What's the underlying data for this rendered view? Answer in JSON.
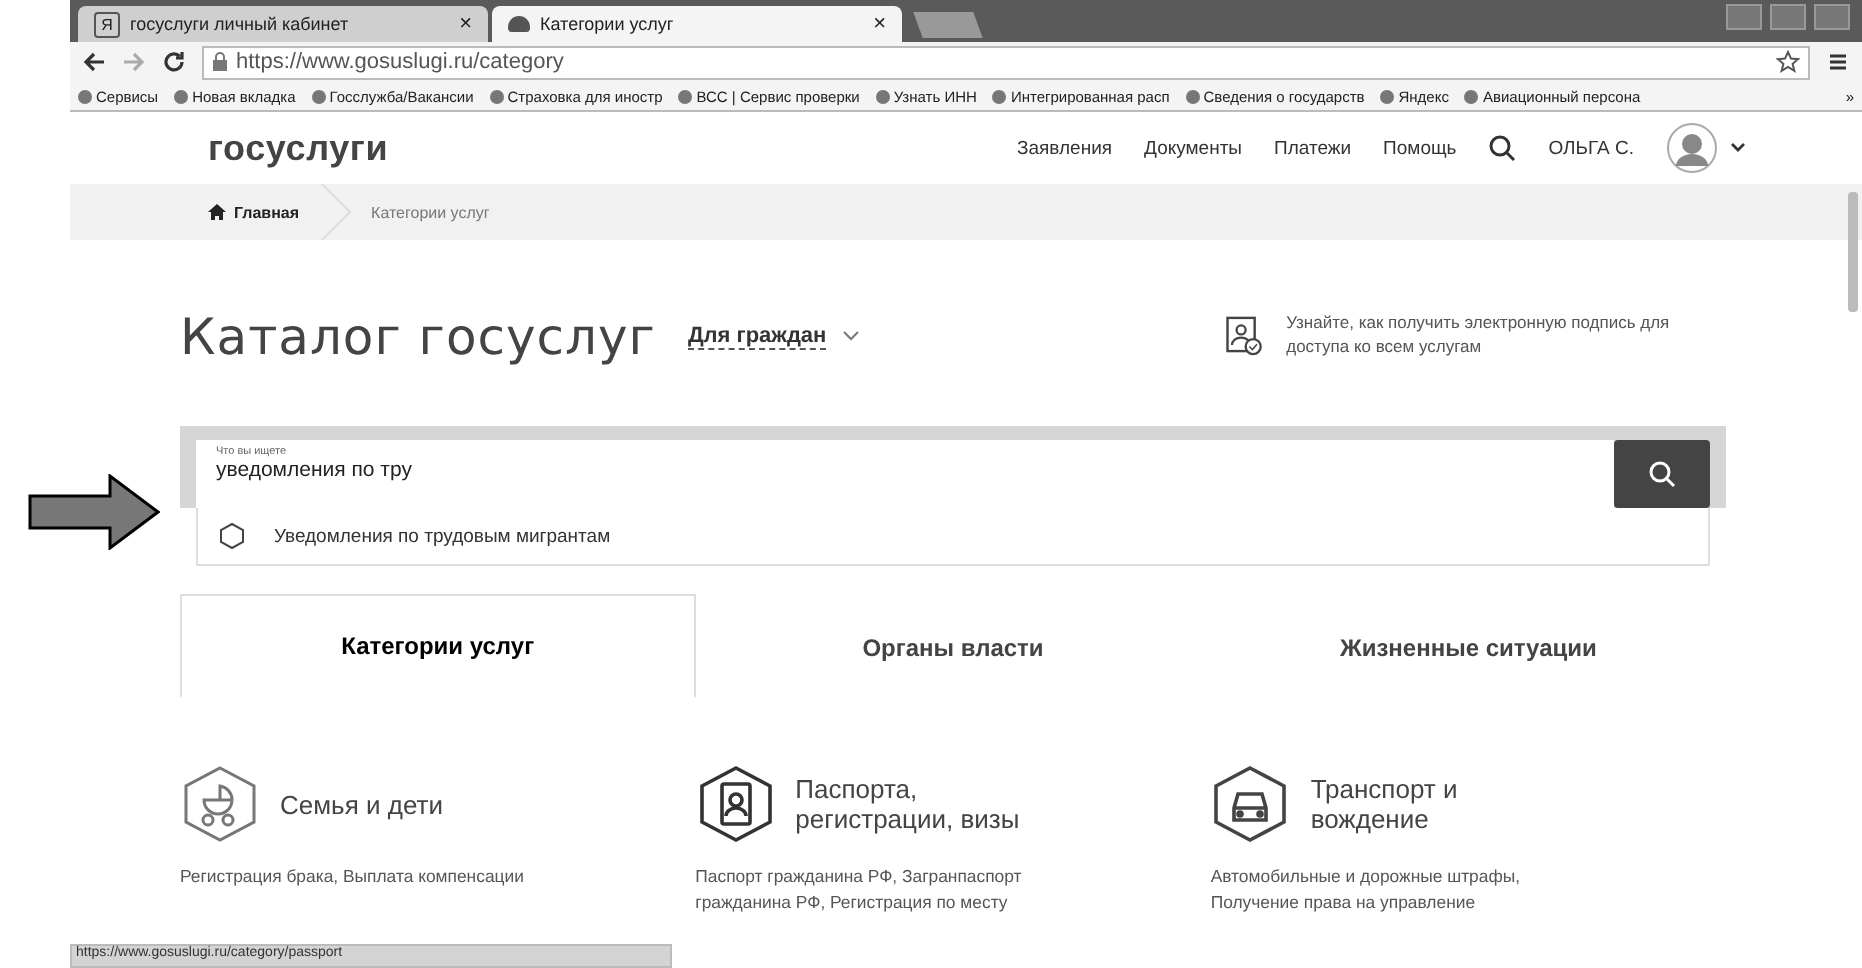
{
  "browser": {
    "tabs": [
      {
        "title": "госуслуги личный кабинет",
        "favicon": "Я",
        "close": "×",
        "selected": false
      },
      {
        "title": "Категории услуг",
        "close": "×",
        "selected": true
      }
    ],
    "url": "https://www.gosuslugi.ru/category",
    "bookmarks": [
      "Сервисы",
      "Новая вкладка",
      "Госслужба/Вакансии",
      "Страховка для иностр",
      "ВСС | Сервис проверки",
      "Узнать ИНН",
      "Интегрированная расп",
      "Сведения о государств",
      "Яндекс",
      "Авиационный персона"
    ],
    "more": "»"
  },
  "header": {
    "logo": "госуслуги",
    "nav": [
      "Заявления",
      "Документы",
      "Платежи",
      "Помощь"
    ],
    "user": "ОЛЬГА С."
  },
  "breadcrumbs": [
    {
      "label": "Главная",
      "kind": "home"
    },
    {
      "label": "Категории услуг",
      "kind": "current"
    }
  ],
  "catalog": {
    "title": "Каталог госуслуг",
    "audience": "Для граждан",
    "hint": "Узнайте, как получить электронную подпись для доступа ко всем услугам"
  },
  "search": {
    "label": "Что вы ищете",
    "value": "уведомления по тру"
  },
  "suggestions": [
    "Уведомления по трудовым мигрантам"
  ],
  "section_tabs": [
    {
      "label": "Категории услуг",
      "selected": true
    },
    {
      "label": "Органы власти",
      "selected": false
    },
    {
      "label": "Жизненные ситуации",
      "selected": false
    }
  ],
  "categories": [
    {
      "title": "Семья и дети",
      "kind": "family",
      "description": [
        "Регистрация брака, Выплата компенсации"
      ]
    },
    {
      "title": "Паспорта, регистрации, визы",
      "kind": "passport",
      "description": [
        "Паспорт гражданина РФ, Загранпаспорт",
        "гражданина РФ, Регистрация по месту"
      ]
    },
    {
      "title": "Транспорт и вождение",
      "kind": "car",
      "description": [
        "Автомобильные и дорожные штрафы,",
        "Получение права на управление"
      ]
    }
  ],
  "status_url": "https://www.gosuslugi.ru/category/passport"
}
